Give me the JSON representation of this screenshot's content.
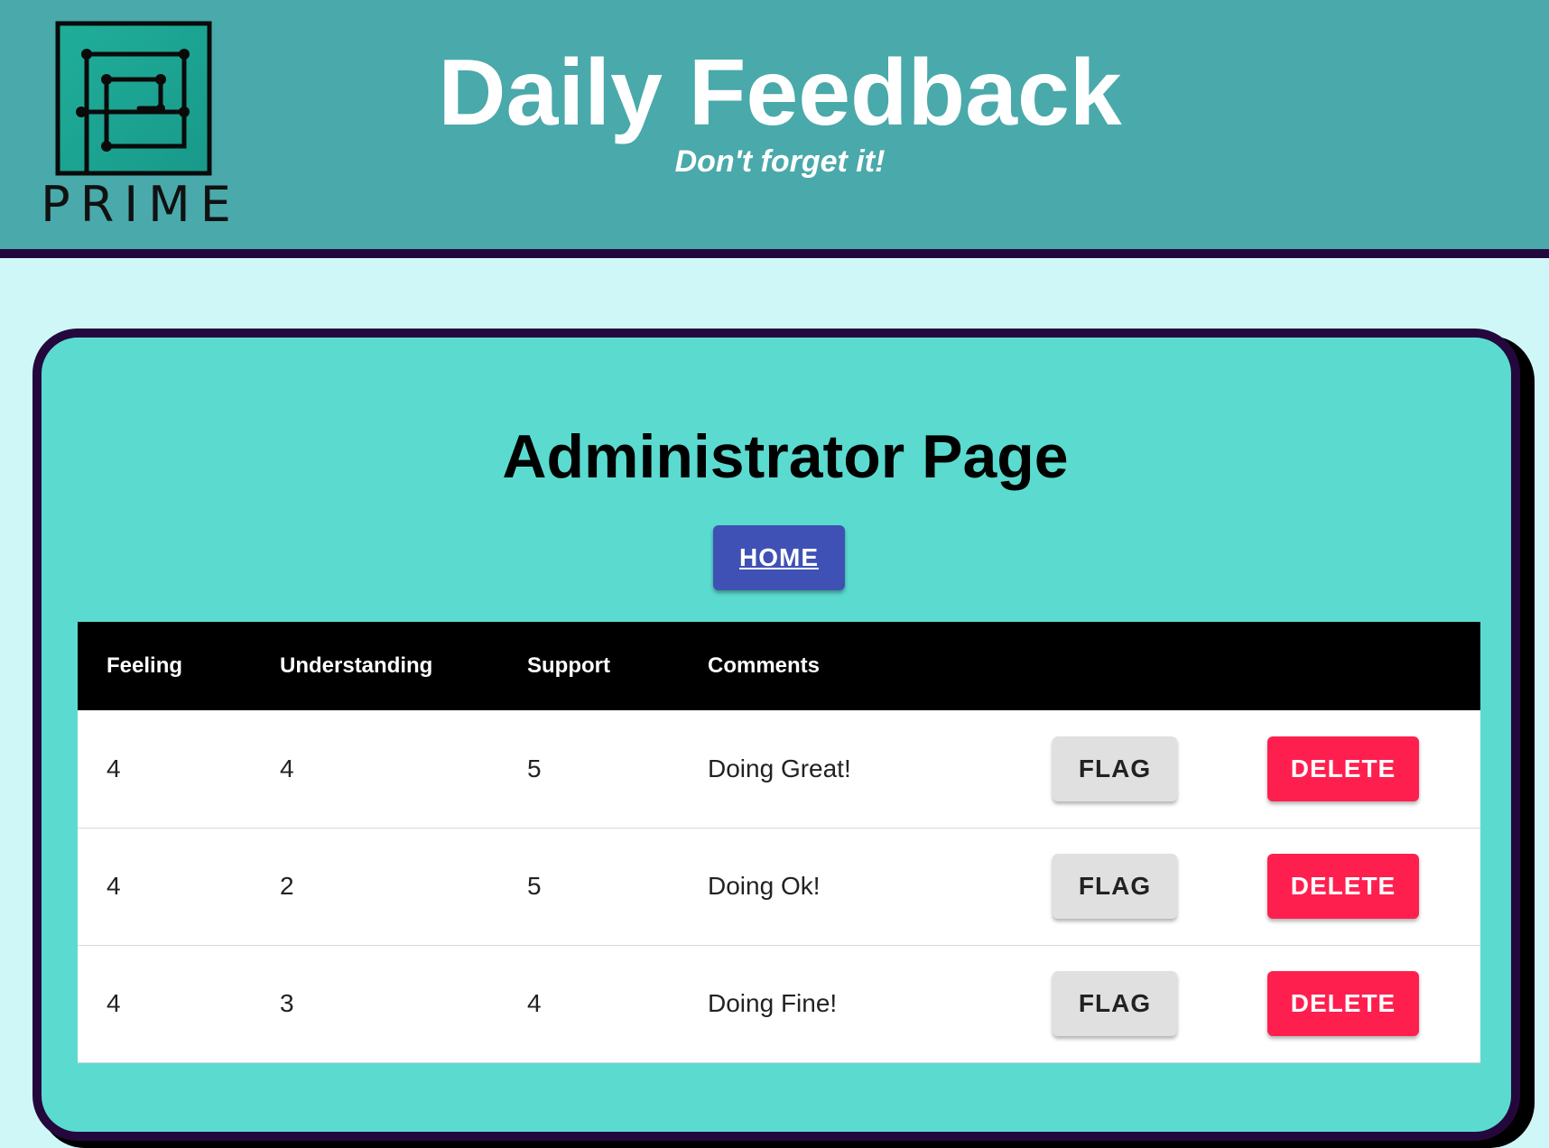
{
  "header": {
    "logo_text": "PRIME",
    "title": "Daily Feedback",
    "subtitle": "Don't forget it!"
  },
  "main": {
    "page_title": "Administrator Page",
    "home_label": "HOME"
  },
  "table": {
    "columns": [
      "Feeling",
      "Understanding",
      "Support",
      "Comments"
    ],
    "flag_label": "FLAG",
    "delete_label": "DELETE",
    "rows": [
      {
        "feeling": "4",
        "understanding": "4",
        "support": "5",
        "comments": "Doing Great!"
      },
      {
        "feeling": "4",
        "understanding": "2",
        "support": "5",
        "comments": "Doing Ok!"
      },
      {
        "feeling": "4",
        "understanding": "3",
        "support": "4",
        "comments": "Doing Fine!"
      }
    ]
  },
  "colors": {
    "header_bg": "#4aa9aa",
    "header_border": "#24083d",
    "page_bg": "#d0f7f7",
    "card_bg": "#5bdbd0",
    "home_button": "#3f51b5",
    "flag_button": "#e0e0e0",
    "delete_button": "#ff1f4f"
  },
  "icons": {
    "logo": "prime-maze-logo-icon"
  }
}
